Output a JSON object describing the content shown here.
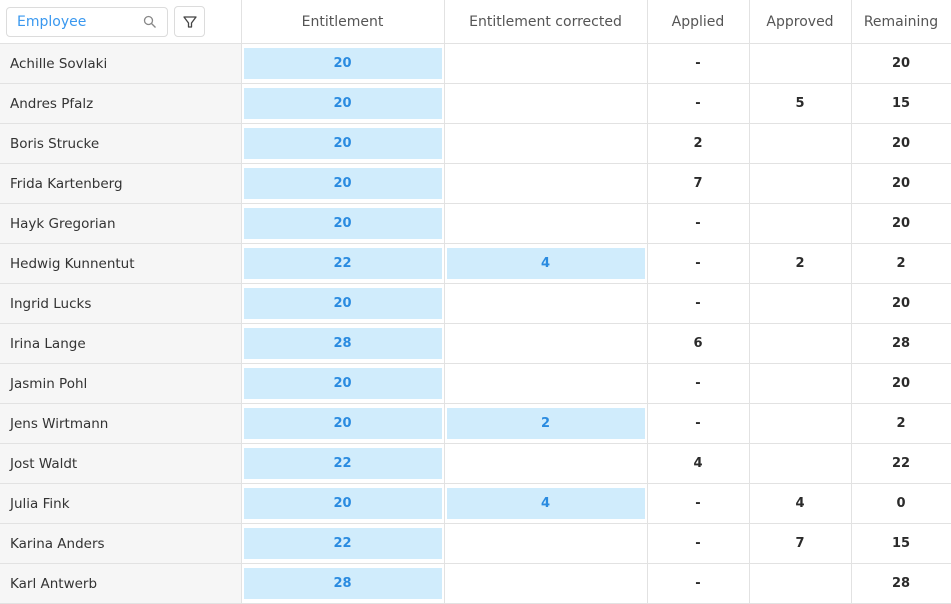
{
  "search": {
    "placeholder": "Employee"
  },
  "columns": [
    "Entitlement",
    "Entitlement corrected",
    "Applied",
    "Approved",
    "Remaining"
  ],
  "rows": [
    {
      "name": "Achille Sovlaki",
      "entitlement": "20",
      "corrected": "",
      "applied": "-",
      "approved": "",
      "remaining": "20"
    },
    {
      "name": "Andres Pfalz",
      "entitlement": "20",
      "corrected": "",
      "applied": "-",
      "approved": "5",
      "remaining": "15"
    },
    {
      "name": "Boris Strucke",
      "entitlement": "20",
      "corrected": "",
      "applied": "2",
      "approved": "",
      "remaining": "20"
    },
    {
      "name": "Frida Kartenberg",
      "entitlement": "20",
      "corrected": "",
      "applied": "7",
      "approved": "",
      "remaining": "20"
    },
    {
      "name": "Hayk Gregorian",
      "entitlement": "20",
      "corrected": "",
      "applied": "-",
      "approved": "",
      "remaining": "20"
    },
    {
      "name": "Hedwig Kunnentut",
      "entitlement": "22",
      "corrected": "4",
      "applied": "-",
      "approved": "2",
      "remaining": "2"
    },
    {
      "name": "Ingrid Lucks",
      "entitlement": "20",
      "corrected": "",
      "applied": "-",
      "approved": "",
      "remaining": "20"
    },
    {
      "name": "Irina Lange",
      "entitlement": "28",
      "corrected": "",
      "applied": "6",
      "approved": "",
      "remaining": "28"
    },
    {
      "name": "Jasmin Pohl",
      "entitlement": "20",
      "corrected": "",
      "applied": "-",
      "approved": "",
      "remaining": "20"
    },
    {
      "name": "Jens Wirtmann",
      "entitlement": "20",
      "corrected": "2",
      "applied": "-",
      "approved": "",
      "remaining": "2"
    },
    {
      "name": "Jost Waldt",
      "entitlement": "22",
      "corrected": "",
      "applied": "4",
      "approved": "",
      "remaining": "22"
    },
    {
      "name": "Julia Fink",
      "entitlement": "20",
      "corrected": "4",
      "applied": "-",
      "approved": "4",
      "remaining": "0"
    },
    {
      "name": "Karina Anders",
      "entitlement": "22",
      "corrected": "",
      "applied": "-",
      "approved": "7",
      "remaining": "15"
    },
    {
      "name": "Karl Antwerb",
      "entitlement": "28",
      "corrected": "",
      "applied": "-",
      "approved": "",
      "remaining": "28"
    }
  ]
}
